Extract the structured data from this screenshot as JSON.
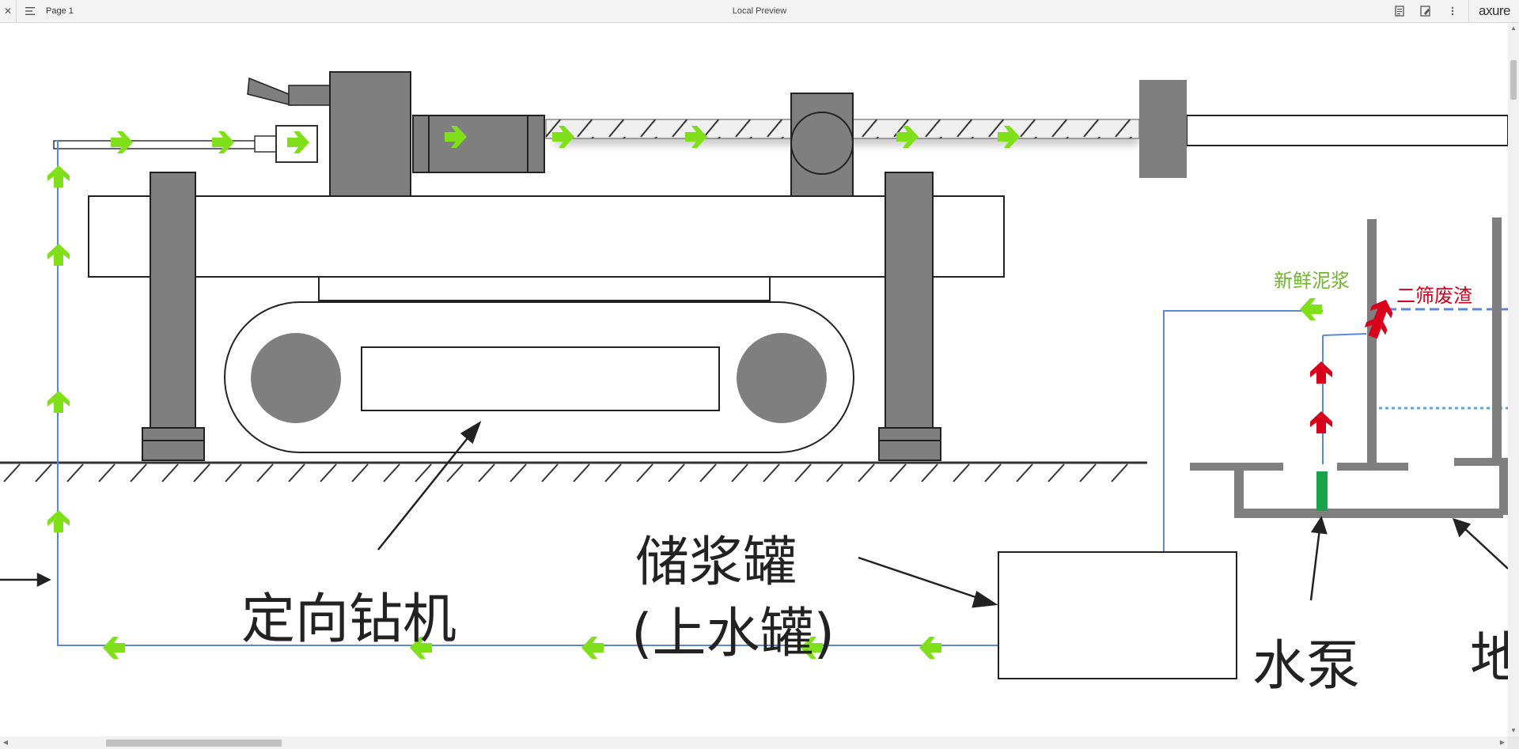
{
  "toolbar": {
    "page_name": "Page 1",
    "title": "Local Preview",
    "brand": "axure",
    "icons": [
      "close-icon",
      "sitemap-menu-icon",
      "notes-icon",
      "inspect-icon",
      "more-icon"
    ]
  },
  "diagram": {
    "labels": {
      "drill": "定向钻机",
      "tank_line1": "储浆罐",
      "tank_line2": "(上水罐)",
      "pump": "水泵",
      "ground_partial": "地",
      "fresh_mud": "新鲜泥浆",
      "second_screen_waste": "二筛废渣"
    },
    "colors": {
      "flow_green": "#7fe01a",
      "flow_red": "#d9001b",
      "pipe_blue": "#5b87d6",
      "machine_gray": "#7f7f7f",
      "fresh_mud_text": "#70b52c",
      "waste_text": "#d9001b",
      "pump_green": "#1aa34a"
    }
  }
}
